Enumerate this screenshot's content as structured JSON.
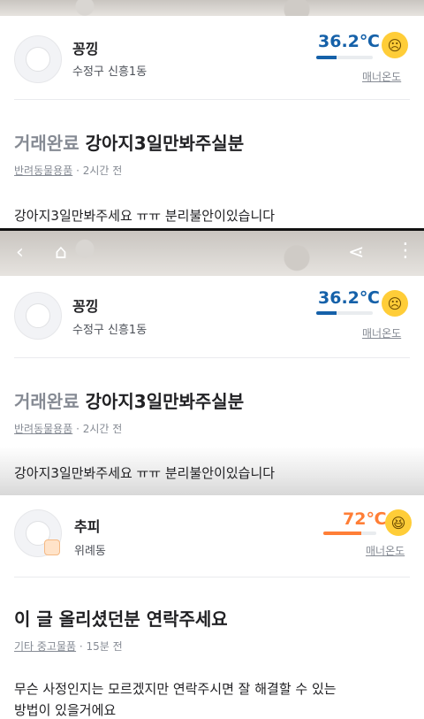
{
  "top": {
    "user": {
      "name": "꽁낑",
      "location": "수정구 신흥1동"
    },
    "temp": {
      "value": "36.2℃",
      "level": 0.36,
      "color": "#1561a9",
      "emoji": "☹"
    },
    "manner_label": "매너온도",
    "post": {
      "status": "거래완료",
      "title": "강아지3일만봐주실분",
      "category": "반려동물용품",
      "time": "· 2시간 전",
      "body": "강아지3일만봐주세요 ㅠㅠ 분리불안이있습니다"
    }
  },
  "middle": {
    "nav": {
      "back_icon": "back-icon",
      "home_icon": "home-icon",
      "share_icon": "share-icon",
      "more_icon": "more-icon"
    },
    "user": {
      "name": "꽁낑",
      "location": "수정구 신흥1동"
    },
    "temp": {
      "value": "36.2℃",
      "level": 0.36,
      "color": "#1561a9",
      "emoji": "☹"
    },
    "manner_label": "매너온도",
    "post": {
      "status": "거래완료",
      "title": "강아지3일만봐주실분",
      "category": "반려동물용품",
      "time": "· 2시간 전",
      "body": "강아지3일만봐주세요 ㅠㅠ 분리불안이있습니다"
    }
  },
  "bottom": {
    "user": {
      "name": "추피",
      "location": "위례동"
    },
    "temp": {
      "value": "72℃",
      "level": 0.72,
      "color": "#ff7e36",
      "emoji": "😆"
    },
    "manner_label": "매너온도",
    "post": {
      "title": "이 글 올리셨던분 연락주세요",
      "category": "기타 중고물품",
      "time": "· 15분 전",
      "body_line1": "무슨 사정인지는 모르겠지만 연락주시면 잘 해결할 수 있는",
      "body_line2": "방법이 있을거에요"
    }
  }
}
